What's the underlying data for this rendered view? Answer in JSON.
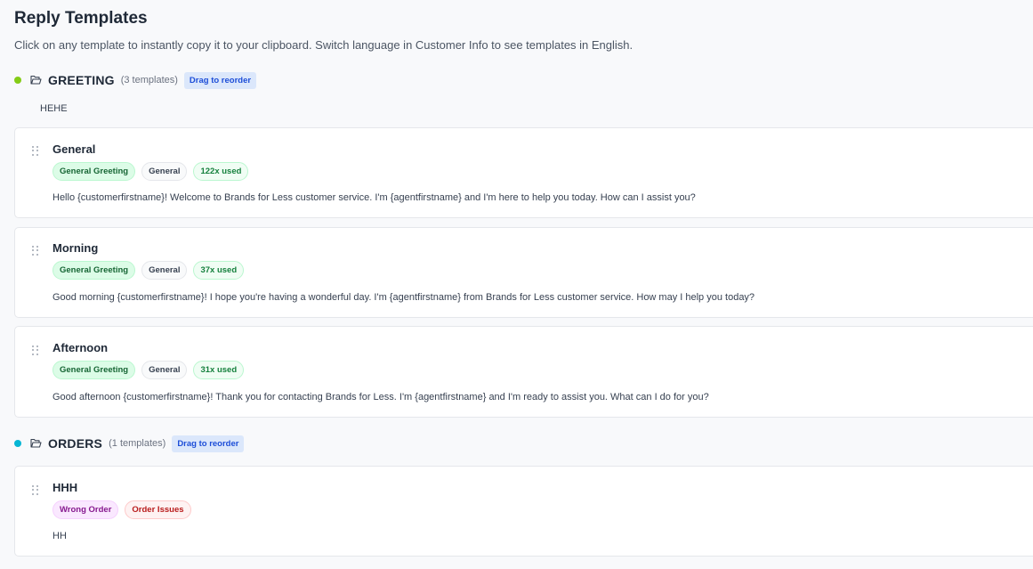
{
  "header": {
    "title": "Reply Templates",
    "subtitle": "Click on any template to instantly copy it to your clipboard. Switch language in Customer Info to see templates in English."
  },
  "icons": {
    "category_folder": "folder-open-icon",
    "drag_handle": "grip-vertical-icon"
  },
  "categories": [
    {
      "name": "GREETING",
      "count_label": "(3 templates)",
      "drag_label": "Drag to reorder",
      "dot_color": "#84cc16",
      "description": "HEHE",
      "templates": [
        {
          "title": "General",
          "tags": [
            "General Greeting",
            "General"
          ],
          "usage": "122x used",
          "body": "Hello {customerfirstname}! Welcome to Brands for Less customer service. I'm {agentfirstname} and I'm here to help you today. How can I assist you?"
        },
        {
          "title": "Morning",
          "tags": [
            "General Greeting",
            "General"
          ],
          "usage": "37x used",
          "body": "Good morning {customerfirstname}! I hope you're having a wonderful day. I'm {agentfirstname} from Brands for Less customer service. How may I help you today?"
        },
        {
          "title": "Afternoon",
          "tags": [
            "General Greeting",
            "General"
          ],
          "usage": "31x used",
          "body": "Good afternoon {customerfirstname}! Thank you for contacting Brands for Less. I'm {agentfirstname} and I'm ready to assist you. What can I do for you?"
        }
      ]
    },
    {
      "name": "ORDERS",
      "count_label": "(1 templates)",
      "drag_label": "Drag to reorder",
      "dot_color": "#06b6d4",
      "templates": [
        {
          "title": "HHH",
          "tags": [
            "Wrong Order",
            "Order Issues"
          ],
          "body": "HH"
        }
      ]
    }
  ]
}
